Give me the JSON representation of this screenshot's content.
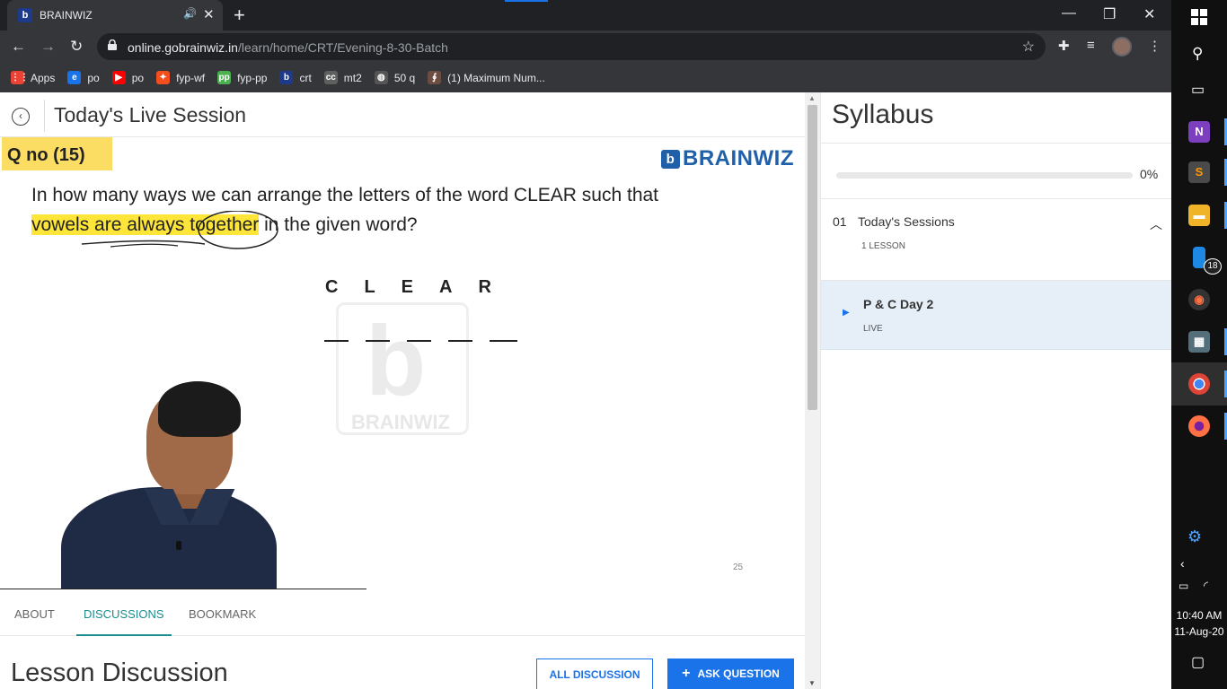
{
  "browser": {
    "tab_title": "BRAINWIZ",
    "tab_favicon": "b",
    "url_host": "online.gobrainwiz.in",
    "url_path": "/learn/home/CRT/Evening-8-30-Batch",
    "window_controls": [
      "minimize-icon",
      "restore-icon",
      "close-icon"
    ],
    "tab_accent": "#1a73e8"
  },
  "bookmarks": [
    {
      "label": "Apps",
      "icon": "apps-grid-icon",
      "color": "#ea4335",
      "glyph": "⋮⋮"
    },
    {
      "label": "po",
      "icon": "edge-icon",
      "color": "#1a73e8",
      "glyph": "e"
    },
    {
      "label": "po",
      "icon": "youtube-icon",
      "color": "#ff0000",
      "glyph": "▶"
    },
    {
      "label": "fyp-wf",
      "icon": "figma-icon",
      "color": "#f24e1e",
      "glyph": "✦"
    },
    {
      "label": "fyp-pp",
      "icon": "pp-icon",
      "color": "#4caf50",
      "glyph": "pp"
    },
    {
      "label": "crt",
      "icon": "brainwiz-icon",
      "color": "#1e3a8a",
      "glyph": "b"
    },
    {
      "label": "mt2",
      "icon": "cc-icon",
      "color": "#5f5f5f",
      "glyph": "cc"
    },
    {
      "label": "50 q",
      "icon": "globe-icon",
      "color": "#555",
      "glyph": "◍"
    },
    {
      "label": "(1) Maximum Num...",
      "icon": "person-icon",
      "color": "#6d4c41",
      "glyph": "∮"
    }
  ],
  "session": {
    "title": "Today's Live Session"
  },
  "slide": {
    "qno": "Q no (15)",
    "logo": "BRAINWIZ",
    "question_line1": "In how many ways we can arrange the letters of the word CLEAR such that",
    "question_line2_highlight": "vowels are always together",
    "question_line2_rest": " in the given word?",
    "word": "CLEAR",
    "watermark_text": "BRAINWIZ",
    "slide_number": "25"
  },
  "tabs": [
    {
      "label": "ABOUT",
      "active": false
    },
    {
      "label": "DISCUSSIONS",
      "active": true
    },
    {
      "label": "BOOKMARK",
      "active": false
    }
  ],
  "discussion": {
    "title": "Lesson Discussion",
    "all_btn": "ALL DISCUSSION",
    "ask_btn": "ASK QUESTION",
    "ask_icon": "+"
  },
  "syllabus": {
    "title": "Syllabus",
    "progress_percent": 0,
    "progress_label": "0%",
    "section_number": "01",
    "section_title": "Today's Sessions",
    "section_count": "1 LESSON",
    "lesson_title": "P & C Day 2",
    "lesson_status": "LIVE"
  },
  "taskbar": {
    "time": "10:40 AM",
    "date": "11-Aug-20",
    "badge_count": "18",
    "apps": [
      "windows-start-icon",
      "search-icon",
      "task-view-icon",
      "onenote-icon",
      "sublime-icon",
      "file-explorer-icon",
      "phone-icon",
      "media-player-icon",
      "calculator-icon",
      "chrome-icon",
      "firefox-icon"
    ]
  }
}
